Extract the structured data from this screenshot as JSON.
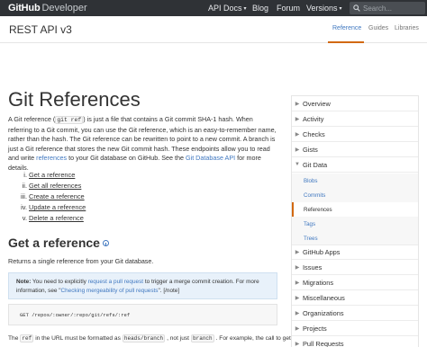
{
  "header": {
    "logo_main": "GitHub",
    "logo_sub": "Developer",
    "nav": [
      {
        "label": "API Docs",
        "has_caret": true
      },
      {
        "label": "Blog",
        "has_caret": false
      },
      {
        "label": "Forum",
        "has_caret": false
      },
      {
        "label": "Versions",
        "has_caret": true
      }
    ],
    "search_placeholder": "Search...",
    "caret_glyph": "▾"
  },
  "subheader": {
    "title": "REST API v3",
    "tabs": [
      {
        "label": "Reference",
        "active": true
      },
      {
        "label": "Guides",
        "active": false
      },
      {
        "label": "Libraries",
        "active": false
      }
    ]
  },
  "main": {
    "title": "Git References",
    "intro": {
      "p1": "A Git reference (",
      "code1": "git ref",
      "p2": ") is just a file that contains a Git commit SHA-1 hash. When referring to a Git commit, you can use the Git reference, which is an easy-to-remember name, rather than the hash. The Git reference can be rewritten to point to a new commit. A branch is just a Git reference that stores the new Git commit hash. These endpoints allow you to read and write ",
      "link1": "references",
      "p3": " to your Git database on GitHub. See the ",
      "link2": "Git Database API",
      "p4": " for more details."
    },
    "toc": [
      {
        "num": "i.",
        "label": "Get a reference"
      },
      {
        "num": "ii.",
        "label": "Get all references"
      },
      {
        "num": "iii.",
        "label": "Create a reference"
      },
      {
        "num": "iv.",
        "label": "Update a reference"
      },
      {
        "num": "v.",
        "label": "Delete a reference"
      }
    ],
    "section_title": "Get a reference",
    "returns": "Returns a single reference from your Git database.",
    "note": {
      "label": "Note:",
      "t1": " You need to explicitly ",
      "link1": "request a pull request",
      "t2": " to trigger a merge commit creation. For more information, see \"",
      "link2": "Checking mergeability of pull requests",
      "t3": "\". [/note]"
    },
    "code": "GET /repos/:owner/:repo/git/refs/:ref",
    "bottom": {
      "t1": "The",
      "c1": "ref",
      "t2": "in the URL must be formatted as",
      "c2": "heads/branch",
      "t3": ", not just",
      "c3": "branch",
      "t4": ". For example, the call to get the"
    }
  },
  "sidebar": {
    "chevron_right": "▶",
    "chevron_down": "▼",
    "items": [
      {
        "label": "Overview",
        "expanded": false
      },
      {
        "label": "Activity",
        "expanded": false
      },
      {
        "label": "Checks",
        "expanded": false
      },
      {
        "label": "Gists",
        "expanded": false
      },
      {
        "label": "Git Data",
        "expanded": true,
        "children": [
          {
            "label": "Blobs",
            "active": false
          },
          {
            "label": "Commits",
            "active": false
          },
          {
            "label": "References",
            "active": true
          },
          {
            "label": "Tags",
            "active": false
          },
          {
            "label": "Trees",
            "active": false
          }
        ]
      },
      {
        "label": "GitHub Apps",
        "expanded": false
      },
      {
        "label": "Issues",
        "expanded": false
      },
      {
        "label": "Migrations",
        "expanded": false
      },
      {
        "label": "Miscellaneous",
        "expanded": false
      },
      {
        "label": "Organizations",
        "expanded": false
      },
      {
        "label": "Projects",
        "expanded": false
      },
      {
        "label": "Pull Requests",
        "expanded": false
      }
    ]
  },
  "colors": {
    "header_bg": "#2f3236",
    "link": "#4078c0",
    "accent": "#d26911",
    "note_bg": "#e8f1fa"
  }
}
